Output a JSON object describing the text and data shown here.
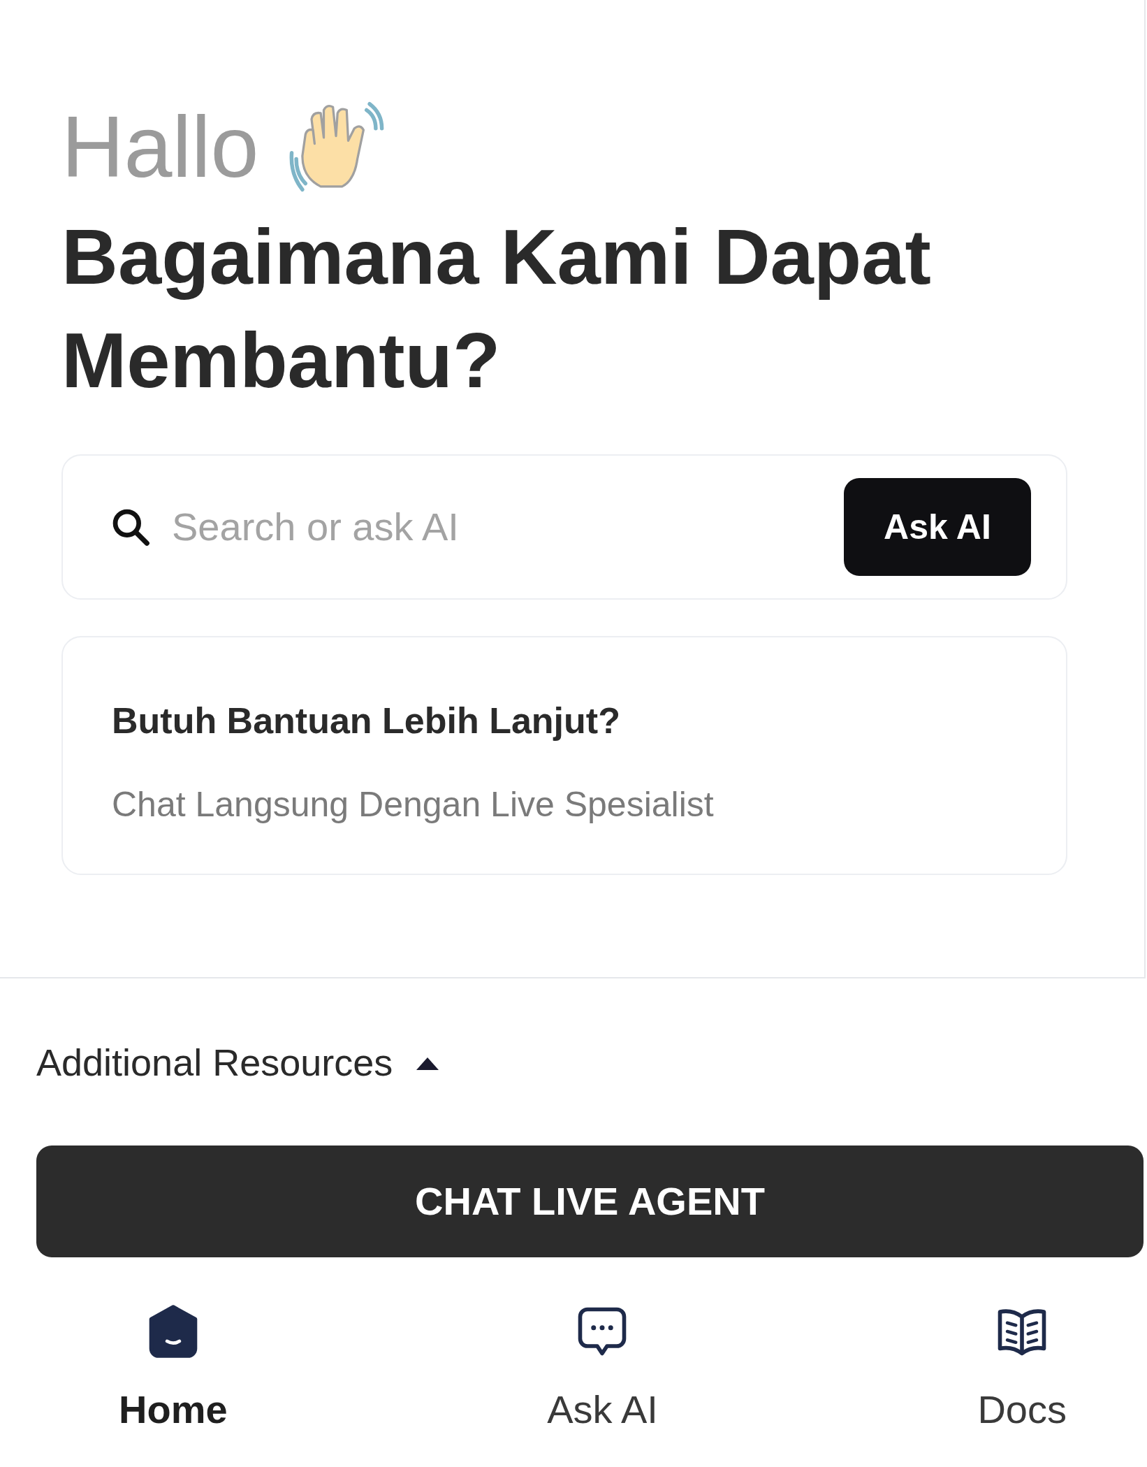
{
  "greeting": "Hallo",
  "heading": "Bagaimana Kami Dapat Membantu?",
  "search": {
    "placeholder": "Search or ask AI",
    "button": "Ask AI"
  },
  "help_card": {
    "title": "Butuh Bantuan Lebih Lanjut?",
    "subtitle": "Chat Langsung Dengan Live Spesialist"
  },
  "resources": {
    "label": "Additional Resources",
    "expanded": true
  },
  "cta_button": "CHAT LIVE AGENT",
  "nav": [
    {
      "kind": "home",
      "label": "Home",
      "selected": true
    },
    {
      "kind": "chat",
      "label": "Ask AI",
      "selected": false
    },
    {
      "kind": "docs",
      "label": "Docs",
      "selected": false
    }
  ]
}
